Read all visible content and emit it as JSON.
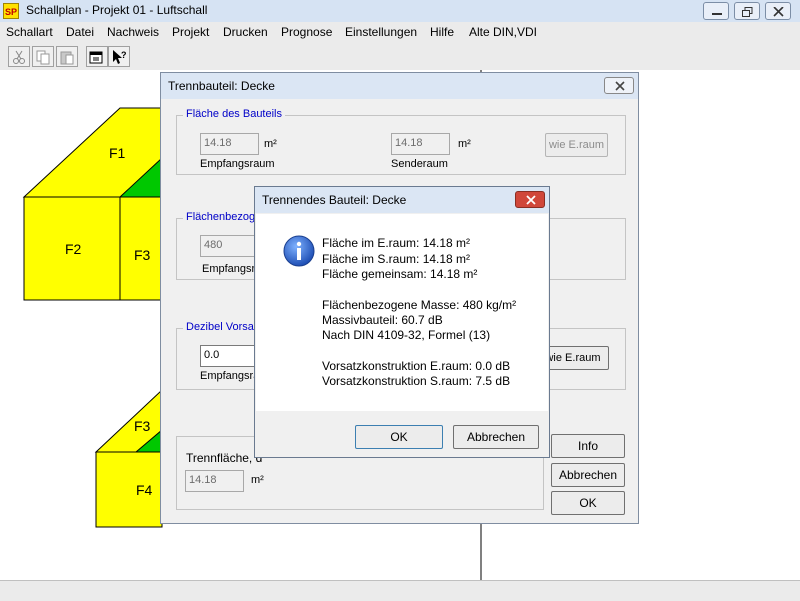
{
  "window": {
    "app_icon": "SP",
    "title": "Schallplan  - Projekt 01 - Luftschall"
  },
  "menu": [
    "Schallart",
    "Datei",
    "Nachweis",
    "Projekt",
    "Drucken",
    "Prognose",
    "Einstellungen",
    "Hilfe",
    "Alte DIN,VDI"
  ],
  "toolbar": [
    "scissors-icon",
    "copy-icon",
    "paste-icon",
    "properties-icon",
    "help-pointer-icon"
  ],
  "diagram": {
    "labels": [
      "F1",
      "F2",
      "F3",
      "F3",
      "F4"
    ]
  },
  "colors": {
    "face_yellow": "#ffff00",
    "face_green": "#00c800",
    "legend_blue": "#0000c8"
  },
  "dialog_main": {
    "title": "Trennbauteil: Decke",
    "group_flaeche": {
      "legend": "Fläche des Bauteils",
      "empfang_value": "14.18",
      "unit": "m²",
      "empfang_label": "Empfangsraum",
      "sende_value": "14.18",
      "sende_label": "Senderaum",
      "wie_button": "wie E.raum"
    },
    "group_masse": {
      "legend": "Flächenbezoge",
      "value": "480",
      "label": "Empfangsra"
    },
    "group_dezibel": {
      "legend": "Dezibel Vorsatz",
      "value": "0.0",
      "label": "Empfangsra",
      "wie_button": "wie E.raum"
    },
    "group_trenn": {
      "label": "Trennfläche, d",
      "value": "14.18",
      "unit": "m²"
    },
    "info_button": "Info",
    "abbrechen_button": "Abbrechen",
    "ok_button": "OK"
  },
  "message": {
    "title": "Trennendes Bauteil: Decke",
    "lines": [
      "Fläche im E.raum: 14.18 m²",
      "Fläche im S.raum: 14.18 m²",
      "Fläche gemeinsam: 14.18 m²",
      "",
      "Flächenbezogene Masse: 480 kg/m²",
      "Massivbauteil: 60.7 dB",
      "Nach DIN 4109-32, Formel (13)",
      "",
      "Vorsatzkonstruktion E.raum: 0.0 dB",
      "Vorsatzkonstruktion S.raum: 7.5 dB"
    ],
    "ok_button": "OK",
    "cancel_button": "Abbrechen"
  }
}
